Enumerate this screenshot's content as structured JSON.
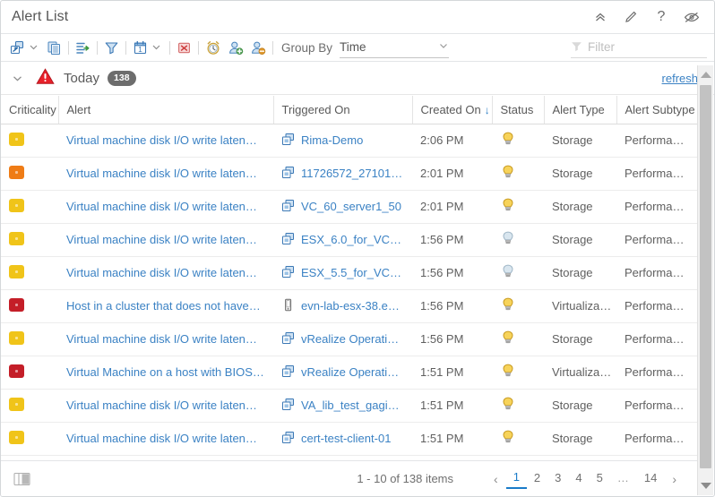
{
  "window": {
    "title": "Alert List",
    "actions": [
      {
        "name": "collapse-icon",
        "label": "Collapse"
      },
      {
        "name": "edit-icon",
        "label": "Edit"
      },
      {
        "name": "help-icon",
        "label": "?"
      },
      {
        "name": "hide-icon",
        "label": "Hide"
      }
    ]
  },
  "toolbar": {
    "icons": [
      {
        "name": "external-link-icon",
        "label": "Open externally"
      },
      {
        "name": "copy-icon",
        "label": "Copy"
      },
      {
        "name": "export-icon",
        "label": "Export"
      },
      {
        "name": "filter-funnel-icon",
        "label": "Filter"
      },
      {
        "name": "calendar-icon",
        "label": "Date range"
      },
      {
        "name": "cancel-alert-icon",
        "label": "Cancel alert"
      },
      {
        "name": "suspend-alert-icon",
        "label": "Suspend alert"
      },
      {
        "name": "take-ownership-icon",
        "label": "Take ownership"
      },
      {
        "name": "release-ownership-icon",
        "label": "Release ownership"
      }
    ],
    "group_by_label": "Group By",
    "group_by_value": "Time",
    "filter_placeholder": "Filter"
  },
  "group_header": {
    "label": "Today",
    "count": "138",
    "refresh_label": "refresh",
    "severity_icon": "critical-warning-icon"
  },
  "table": {
    "columns": [
      {
        "key": "criticality",
        "label": "Criticality"
      },
      {
        "key": "alert",
        "label": "Alert"
      },
      {
        "key": "triggered_on",
        "label": "Triggered On"
      },
      {
        "key": "created_on",
        "label": "Created On",
        "sorted": "desc",
        "sort_glyph": "↓"
      },
      {
        "key": "status",
        "label": "Status"
      },
      {
        "key": "alert_type",
        "label": "Alert Type"
      },
      {
        "key": "alert_subtype",
        "label": "Alert Subtype"
      }
    ],
    "rows": [
      {
        "criticality": "warning",
        "criticality_color": "#f0c419",
        "alert": "Virtual machine disk I/O write laten…",
        "object_icon": "virtual-machine-icon",
        "triggered_on": "Rima-Demo",
        "created_on": "2:06 PM",
        "status_icon": "bulb-on-icon",
        "status": "active",
        "alert_type": "Storage",
        "alert_subtype": "Performa…"
      },
      {
        "criticality": "immediate",
        "criticality_color": "#ef7c16",
        "alert": "Virtual machine disk I/O write laten…",
        "object_icon": "virtual-machine-icon",
        "triggered_on": "11726572_271017…",
        "created_on": "2:01 PM",
        "status_icon": "bulb-on-icon",
        "status": "active",
        "alert_type": "Storage",
        "alert_subtype": "Performa…"
      },
      {
        "criticality": "warning",
        "criticality_color": "#f0c419",
        "alert": "Virtual machine disk I/O write laten…",
        "object_icon": "virtual-machine-icon",
        "triggered_on": "VC_60_server1_50",
        "created_on": "2:01 PM",
        "status_icon": "bulb-on-icon",
        "status": "active",
        "alert_type": "Storage",
        "alert_subtype": "Performa…"
      },
      {
        "criticality": "warning",
        "criticality_color": "#f0c419",
        "alert": "Virtual machine disk I/O write laten…",
        "object_icon": "virtual-machine-icon",
        "triggered_on": "ESX_6.0_for_VC…",
        "created_on": "1:56 PM",
        "status_icon": "bulb-off-icon",
        "status": "inactive",
        "alert_type": "Storage",
        "alert_subtype": "Performa…"
      },
      {
        "criticality": "warning",
        "criticality_color": "#f0c419",
        "alert": "Virtual machine disk I/O write laten…",
        "object_icon": "virtual-machine-icon",
        "triggered_on": "ESX_5.5_for_VC…",
        "created_on": "1:56 PM",
        "status_icon": "bulb-off-icon",
        "status": "inactive",
        "alert_type": "Storage",
        "alert_subtype": "Performa…"
      },
      {
        "criticality": "critical",
        "criticality_color": "#c41e28",
        "alert": "Host in a cluster that does not have…",
        "object_icon": "host-system-icon",
        "triggered_on": "evn-lab-esx-38.e…",
        "created_on": "1:56 PM",
        "status_icon": "bulb-on-icon",
        "status": "active",
        "alert_type": "Virtualiza…",
        "alert_subtype": "Performa…"
      },
      {
        "criticality": "warning",
        "criticality_color": "#f0c419",
        "alert": "Virtual machine disk I/O write laten…",
        "object_icon": "virtual-machine-icon",
        "triggered_on": "vRealize Operatio…",
        "created_on": "1:56 PM",
        "status_icon": "bulb-on-icon",
        "status": "active",
        "alert_type": "Storage",
        "alert_subtype": "Performa…"
      },
      {
        "criticality": "critical",
        "criticality_color": "#c41e28",
        "alert": "Virtual Machine on a host with BIOS…",
        "object_icon": "virtual-machine-icon",
        "triggered_on": "vRealize Operatio…",
        "created_on": "1:51 PM",
        "status_icon": "bulb-on-icon",
        "status": "active",
        "alert_type": "Virtualiza…",
        "alert_subtype": "Performa…"
      },
      {
        "criticality": "warning",
        "criticality_color": "#f0c419",
        "alert": "Virtual machine disk I/O write laten…",
        "object_icon": "virtual-machine-icon",
        "triggered_on": "VA_lib_test_gagi…",
        "created_on": "1:51 PM",
        "status_icon": "bulb-on-icon",
        "status": "active",
        "alert_type": "Storage",
        "alert_subtype": "Performa…"
      },
      {
        "criticality": "warning",
        "criticality_color": "#f0c419",
        "alert": "Virtual machine disk I/O write laten…",
        "object_icon": "virtual-machine-icon",
        "triggered_on": "cert-test-client-01",
        "created_on": "1:51 PM",
        "status_icon": "bulb-on-icon",
        "status": "active",
        "alert_type": "Storage",
        "alert_subtype": "Performa…"
      }
    ]
  },
  "footer": {
    "split_icon": "split-panel-icon",
    "items_text": "1 - 10 of 138 items",
    "prev_glyph": "‹",
    "next_glyph": "›",
    "pages": [
      "1",
      "2",
      "3",
      "4",
      "5",
      "…",
      "14"
    ],
    "active_page": "1"
  },
  "colors": {
    "link": "#3b82c4",
    "accent": "#1a7bc9",
    "critical": "#c41e28",
    "immediate": "#ef7c16",
    "warning": "#f0c419"
  }
}
